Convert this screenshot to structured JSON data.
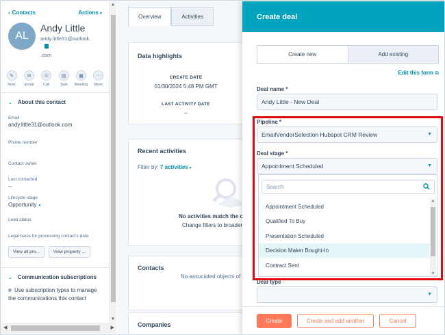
{
  "sidebar": {
    "back_label": "Contacts",
    "actions_label": "Actions",
    "avatar_initials": "AL",
    "contact_name": "Andy Little",
    "contact_email_line1": "andy.little31@outlook",
    "contact_email_line2": ".com",
    "actions": [
      {
        "label": "Note",
        "icon": "note-icon",
        "glyph": "✎"
      },
      {
        "label": "Email",
        "icon": "email-icon",
        "glyph": "✉"
      },
      {
        "label": "Call",
        "icon": "call-icon",
        "glyph": "☏"
      },
      {
        "label": "Task",
        "icon": "task-icon",
        "glyph": "▤"
      },
      {
        "label": "Meeting",
        "icon": "meeting-icon",
        "glyph": "▦"
      },
      {
        "label": "More",
        "icon": "more-icon",
        "glyph": "···"
      }
    ],
    "about_heading": "About this contact",
    "email_label": "Email",
    "email_value": "andy.little31@outlook.com",
    "phone_label": "Phone number",
    "owner_label": "Contact owner",
    "last_contacted_label": "Last contacted",
    "last_contacted_value": "--",
    "lifecycle_label": "Lifecycle stage",
    "lifecycle_value": "Opportunity",
    "lead_status_label": "Lead status",
    "legal_basis_label": "Legal basis for processing contact's data",
    "view_all_label": "View all pro...",
    "view_property_label": "View property ...",
    "comm_heading": "Communication subscriptions",
    "comm_text_line1": "Use subscription types to manage",
    "comm_text_line2": "the communications this contact"
  },
  "middle": {
    "tabs": [
      "Overview",
      "Activities"
    ],
    "highlights_title": "Data highlights",
    "create_date_label": "CREATE DATE",
    "create_date_value": "01/30/2024 5:48 PM GMT",
    "last_activity_label": "LAST ACTIVITY DATE",
    "last_activity_value": "--",
    "recent_title": "Recent activities",
    "filter_prefix": "Filter by:",
    "filter_value": "7 activities",
    "empty_title": "No activities match the c",
    "empty_sub": "Change filters to broader",
    "contacts_title": "Contacts",
    "contacts_empty": "No associated objects of t",
    "companies_title": "Companies"
  },
  "panel": {
    "title": "Create deal",
    "tab_new": "Create new",
    "tab_existing": "Add existing",
    "edit_form": "Edit this form",
    "deal_name_label": "Deal name *",
    "deal_name_value": "Andy Little - New Deal",
    "pipeline_label": "Pipeline *",
    "pipeline_value": "EmailVendorSelection Hubspot CRM Review",
    "stage_label": "Deal stage *",
    "stage_value": "Appointment Scheduled",
    "search_placeholder": "Search",
    "options": [
      "Appointment Scheduled",
      "Qualified To Buy",
      "Presentation Scheduled",
      "Decision Maker Bought-In",
      "Contract Sent"
    ],
    "deal_type_label": "Deal type",
    "create_label": "Create",
    "create_another_label": "Create and add another",
    "cancel_label": "Cancel"
  },
  "colors": {
    "accent": "#00a4bd",
    "primary_button": "#ff7a59",
    "highlight_box": "#e0070d",
    "link": "#0091ae"
  }
}
